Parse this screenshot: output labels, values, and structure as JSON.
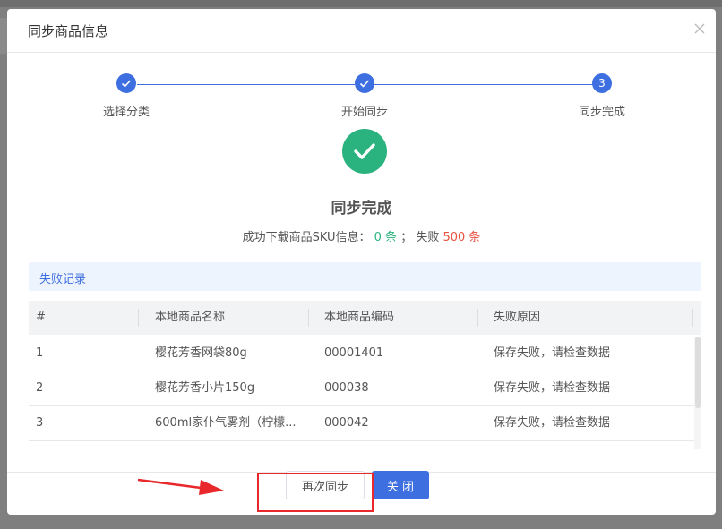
{
  "dialog": {
    "title": "同步商品信息"
  },
  "steps": [
    {
      "label": "选择分类",
      "status": "done"
    },
    {
      "label": "开始同步",
      "status": "done"
    },
    {
      "label": "同步完成",
      "number": "3",
      "status": "active"
    }
  ],
  "result": {
    "icon": "check-circle-icon",
    "title": "同步完成",
    "summary_prefix": "成功下载商品SKU信息：",
    "success_count": "0 条",
    "separator": "；  失败",
    "fail_count": "500 条"
  },
  "fail_section": {
    "label": "失败记录"
  },
  "table": {
    "headers": [
      "#",
      "本地商品名称",
      "本地商品编码",
      "失败原因"
    ],
    "rows": [
      {
        "index": "1",
        "name": "樱花芳香网袋80g",
        "code": "00001401",
        "reason": "保存失败，请检查数据"
      },
      {
        "index": "2",
        "name": "樱花芳香小片150g",
        "code": "000038",
        "reason": "保存失败，请检查数据"
      },
      {
        "index": "3",
        "name": "600ml家仆气雾剂（柠檬...",
        "code": "000042",
        "reason": "保存失败，请检查数据"
      }
    ]
  },
  "footer": {
    "resync_label": "再次同步",
    "close_label": "关 闭"
  },
  "colors": {
    "primary": "#3e6fe0",
    "success": "#2bb37f",
    "danger": "#e8523f",
    "annotation": "#e8282a"
  }
}
